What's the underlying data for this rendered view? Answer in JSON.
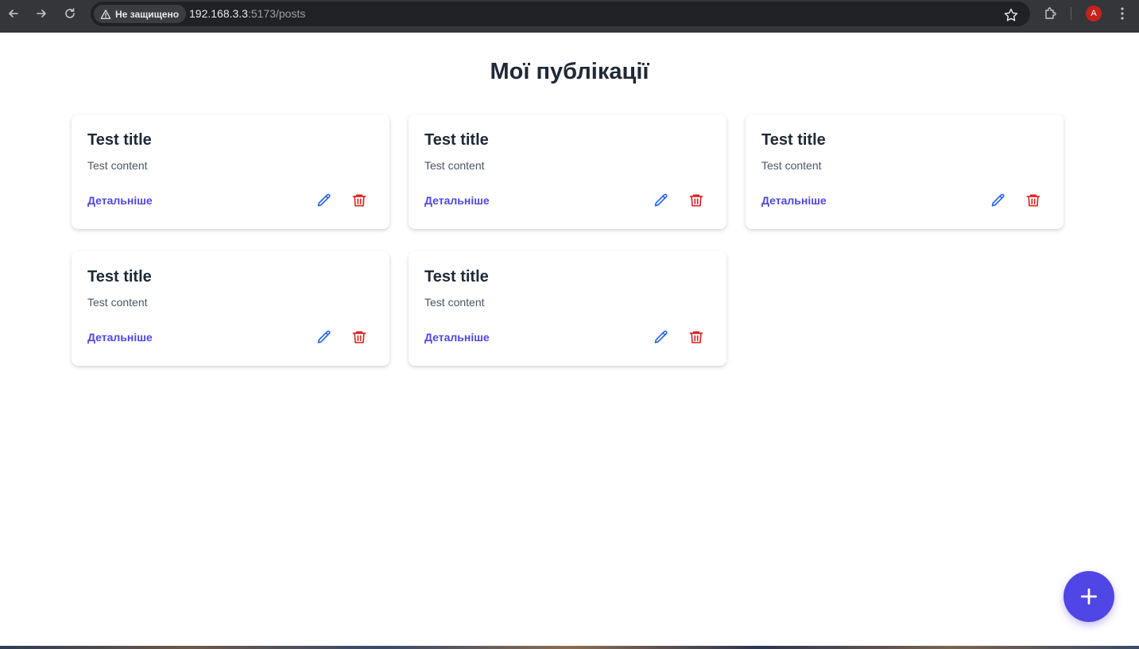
{
  "browser": {
    "security_label": "Не защищено",
    "url_host": "192.168.3.3",
    "url_path": ":5173/posts",
    "avatar_letter": "A"
  },
  "page": {
    "title": "Мої публікації"
  },
  "posts": [
    {
      "title": "Test title",
      "content": "Test content",
      "link_label": "Детальніше"
    },
    {
      "title": "Test title",
      "content": "Test content",
      "link_label": "Детальніше"
    },
    {
      "title": "Test title",
      "content": "Test content",
      "link_label": "Детальніше"
    },
    {
      "title": "Test title",
      "content": "Test content",
      "link_label": "Детальніше"
    },
    {
      "title": "Test title",
      "content": "Test content",
      "link_label": "Детальніше"
    }
  ],
  "icons": {
    "back": "arrow-left-icon",
    "forward": "arrow-right-icon",
    "reload": "reload-icon",
    "warning": "warning-triangle-icon",
    "bookmark": "star-icon",
    "extensions": "puzzle-icon",
    "menu": "kebab-menu-icon",
    "edit": "pencil-icon",
    "delete": "trash-icon",
    "add": "plus-icon"
  },
  "colors": {
    "accent": "#4f46e5",
    "edit_icon": "#2563eb",
    "delete_icon": "#dc2626",
    "title_text": "#1f2937"
  }
}
